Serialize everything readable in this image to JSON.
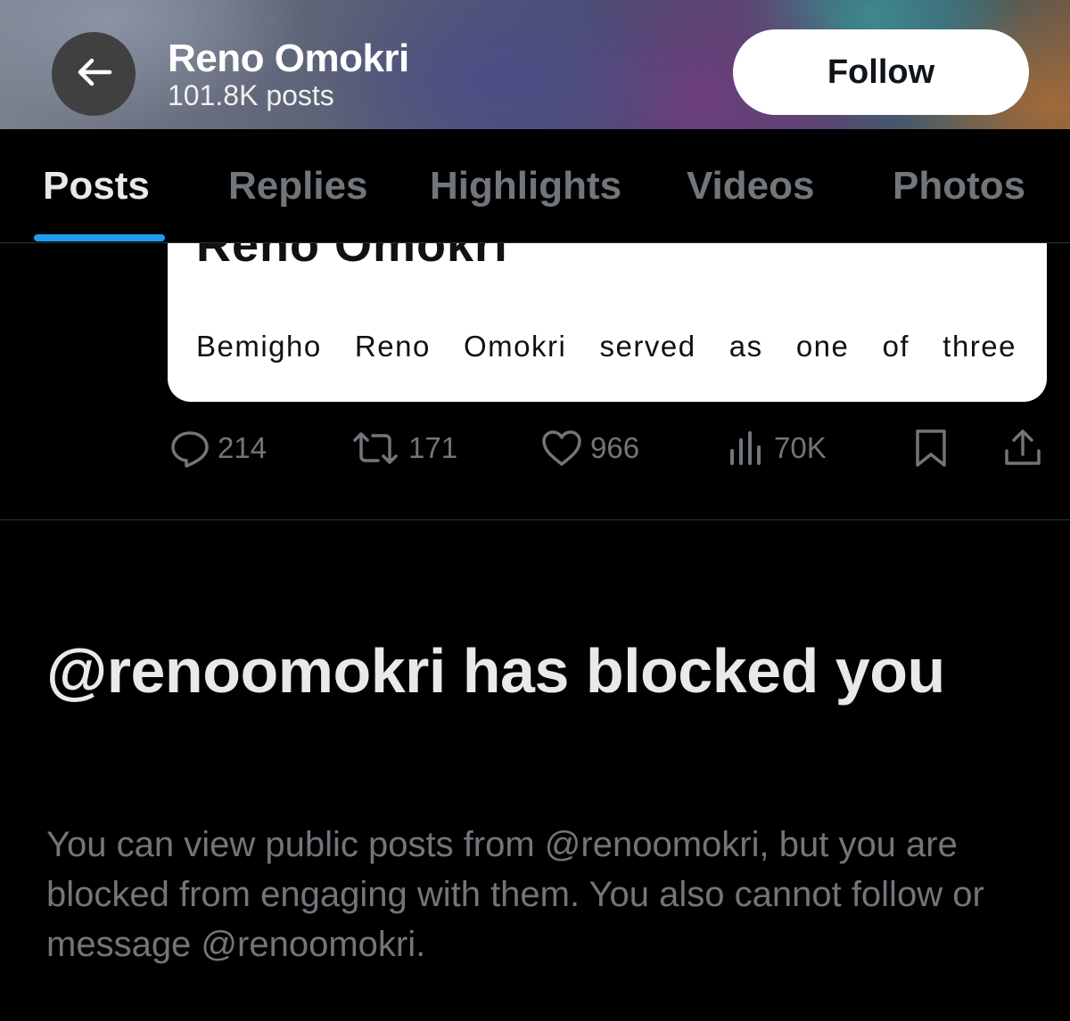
{
  "header": {
    "title": "Reno Omokri",
    "post_count": "101.8K posts",
    "follow_label": "Follow",
    "back_icon": "arrow-left-icon"
  },
  "tabs": [
    {
      "label": "Posts",
      "active": true
    },
    {
      "label": "Replies",
      "active": false
    },
    {
      "label": "Highlights",
      "active": false
    },
    {
      "label": "Videos",
      "active": false
    },
    {
      "label": "Photos",
      "active": false
    }
  ],
  "card": {
    "title": "Reno Omokri",
    "body": "Bemigho Reno Omokri served as one of three"
  },
  "actions": {
    "replies": "214",
    "reposts": "171",
    "likes": "966",
    "views": "70K"
  },
  "blocked": {
    "title": "@renoomokri has blocked you",
    "description": "You can view public posts from @renoomokri, but you are blocked from engaging with them. You also cannot follow or message @renoomokri."
  },
  "colors": {
    "accent": "#1d9bf0",
    "background": "#000000",
    "muted_text": "#71767b",
    "primary_text": "#e7e9ea"
  }
}
